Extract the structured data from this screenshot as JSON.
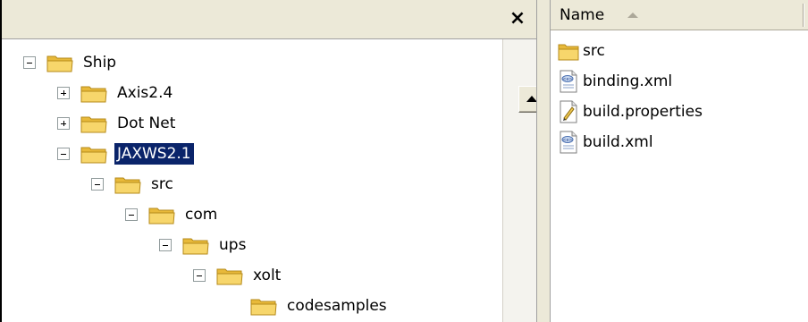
{
  "tree_pane": {
    "close_glyph": "×",
    "nodes": [
      {
        "label": "Ship",
        "expander": "minus",
        "icon": "folder-icon"
      },
      {
        "label": "Axis2.4",
        "expander": "plus",
        "icon": "folder-icon"
      },
      {
        "label": "Dot Net",
        "expander": "plus",
        "icon": "folder-icon"
      },
      {
        "label": "JAXWS2.1",
        "expander": "minus",
        "icon": "folder-icon",
        "selected": true
      },
      {
        "label": "src",
        "expander": "minus",
        "icon": "folder-icon"
      },
      {
        "label": "com",
        "expander": "minus",
        "icon": "folder-icon"
      },
      {
        "label": "ups",
        "expander": "minus",
        "icon": "folder-icon"
      },
      {
        "label": "xolt",
        "expander": "minus",
        "icon": "folder-icon"
      },
      {
        "label": "codesamples",
        "expander": "none",
        "icon": "folder-icon"
      }
    ]
  },
  "file_pane": {
    "column_header": "Name",
    "sort_direction": "ascending",
    "files": [
      {
        "label": "src",
        "icon": "folder-icon"
      },
      {
        "label": "binding.xml",
        "icon": "xml-file-icon"
      },
      {
        "label": "build.properties",
        "icon": "properties-file-icon"
      },
      {
        "label": "build.xml",
        "icon": "xml-file-icon"
      }
    ]
  },
  "colors": {
    "selection": "#0a246a",
    "folder_body": "#f7d66b",
    "chrome": "#ece9d8"
  }
}
